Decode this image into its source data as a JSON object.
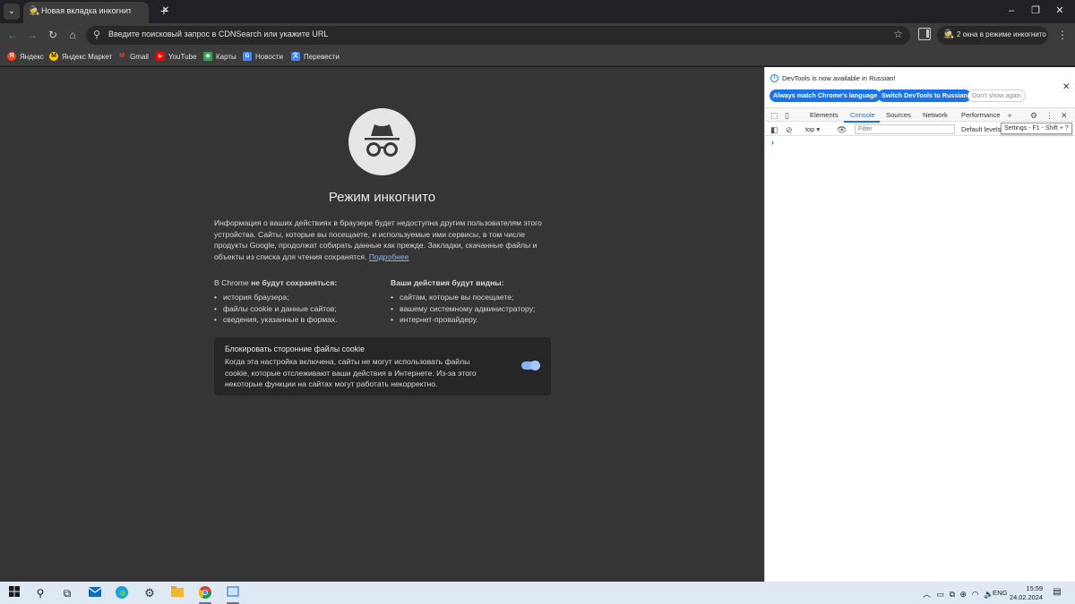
{
  "tab": {
    "title": "Новая вкладка инкогнито",
    "close": "✕",
    "new_tab": "+",
    "list": "⌄"
  },
  "window": {
    "minimize": "–",
    "maximize": "❐",
    "close": "✕"
  },
  "omnibox": {
    "placeholder": "Введите поисковый запрос в CDNSearch или укажите URL"
  },
  "incognito_windows": {
    "label": "2 окна в режиме инкогнито"
  },
  "bookmarks": [
    {
      "label": "Яндекс",
      "icon": "yandex-icon",
      "color": "#fc3f1d",
      "glyph": "Я"
    },
    {
      "label": "Яндекс Маркет",
      "icon": "yandex-market-icon",
      "color": "#ffcc00",
      "glyph": "M"
    },
    {
      "label": "Gmail",
      "icon": "gmail-icon",
      "color": "#ea4335",
      "glyph": "M"
    },
    {
      "label": "YouTube",
      "icon": "youtube-icon",
      "color": "#ff0000",
      "glyph": "▶"
    },
    {
      "label": "Карты",
      "icon": "maps-icon",
      "color": "#34a853",
      "glyph": "◆"
    },
    {
      "label": "Новости",
      "icon": "news-icon",
      "color": "#4285f4",
      "glyph": "G"
    },
    {
      "label": "Перевести",
      "icon": "translate-icon",
      "color": "#4285f4",
      "glyph": "文"
    }
  ],
  "incognito": {
    "title": "Режим инкогнито",
    "intro": "Информация о ваших действиях в браузере будет недоступна другим пользователям этого устройства. Сайты, которые вы посещаете, и используемые ими сервисы, в том числе продукты Google, продолжат собирать данные как прежде. Закладки, скачанные файлы и объекты из списка для чтения сохранятся.",
    "learn_more": "Подробнее",
    "not_saved": {
      "prefix": "В Chrome ",
      "bold": "не будут сохраняться:",
      "items": [
        "история браузера;",
        "файлы cookie и данные сайтов;",
        "сведения, указанные в формах."
      ]
    },
    "visible": {
      "bold": "Ваши действия будут видны:",
      "items": [
        "сайтам, которые вы посещаете;",
        "вашему системному администратору;",
        "интернет-провайдеру."
      ]
    },
    "cookie": {
      "title": "Блокировать сторонние файлы cookie",
      "description": "Когда эта настройка включена, сайты не могут использовать файлы cookie, которые отслеживают ваши действия в Интернете. Из-за этого некоторые функции на сайтах могут работать некорректно.",
      "enabled": true
    }
  },
  "devtools": {
    "banner": "DevTools is now available in Russian!",
    "btn_match": "Always match Chrome's language",
    "btn_switch": "Switch DevTools to Russian",
    "btn_dont": "Don't show again",
    "tabs": [
      "Elements",
      "Console",
      "Sources",
      "Network",
      "Performance"
    ],
    "more_tabs": "»",
    "active_tab": "Console",
    "context": "top",
    "filter_placeholder": "Filter",
    "levels": "Default levels",
    "tooltip": "Settings - F1 - Shift + ?",
    "prompt": "›"
  },
  "taskbar": {
    "language": "ENG",
    "time": "15:59",
    "date": "24.02.2024"
  }
}
